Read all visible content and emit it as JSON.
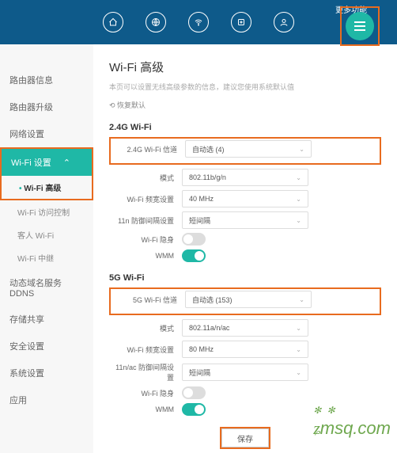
{
  "topbar": {
    "more_label": "更多功能"
  },
  "sidebar": {
    "router_info": "路由器信息",
    "router_upgrade": "路由器升级",
    "network_settings": "网络设置",
    "wifi_settings": "Wi-Fi 设置",
    "sub_wifi_advanced": "Wi-Fi 高级",
    "sub_wifi_access": "Wi-Fi 访问控制",
    "sub_guest_wifi": "客人 Wi-Fi",
    "sub_wifi_repeater": "Wi-Fi 中继",
    "ddns": "动态域名服务 DDNS",
    "storage": "存储共享",
    "security": "安全设置",
    "system": "系统设置",
    "app": "应用"
  },
  "content": {
    "title": "Wi-Fi 高级",
    "desc": "本页可以设置无线高级参数的信息，建议您使用系统默认值",
    "reset": "恢复默认",
    "section24": "2.4G Wi-Fi",
    "section5": "5G Wi-Fi",
    "labels": {
      "channel24": "2.4G Wi-Fi 信道",
      "channel5": "5G Wi-Fi 信道",
      "mode": "模式",
      "bandwidth": "Wi-Fi 频宽设置",
      "guard11n": "11n 防御间隔设置",
      "guard11ac": "11n/ac 防御间隔设置",
      "hidden": "Wi-Fi 隐身",
      "wmm": "WMM"
    },
    "values": {
      "channel24": "自动选 (4)",
      "mode24": "802.11b/g/n",
      "bw24": "40 MHz",
      "guard24": "短间隔",
      "channel5": "自动选 (153)",
      "mode5": "802.11a/n/ac",
      "bw5": "80 MHz",
      "guard5": "短间隔"
    },
    "save": "保存"
  },
  "watermark": "msq.com"
}
